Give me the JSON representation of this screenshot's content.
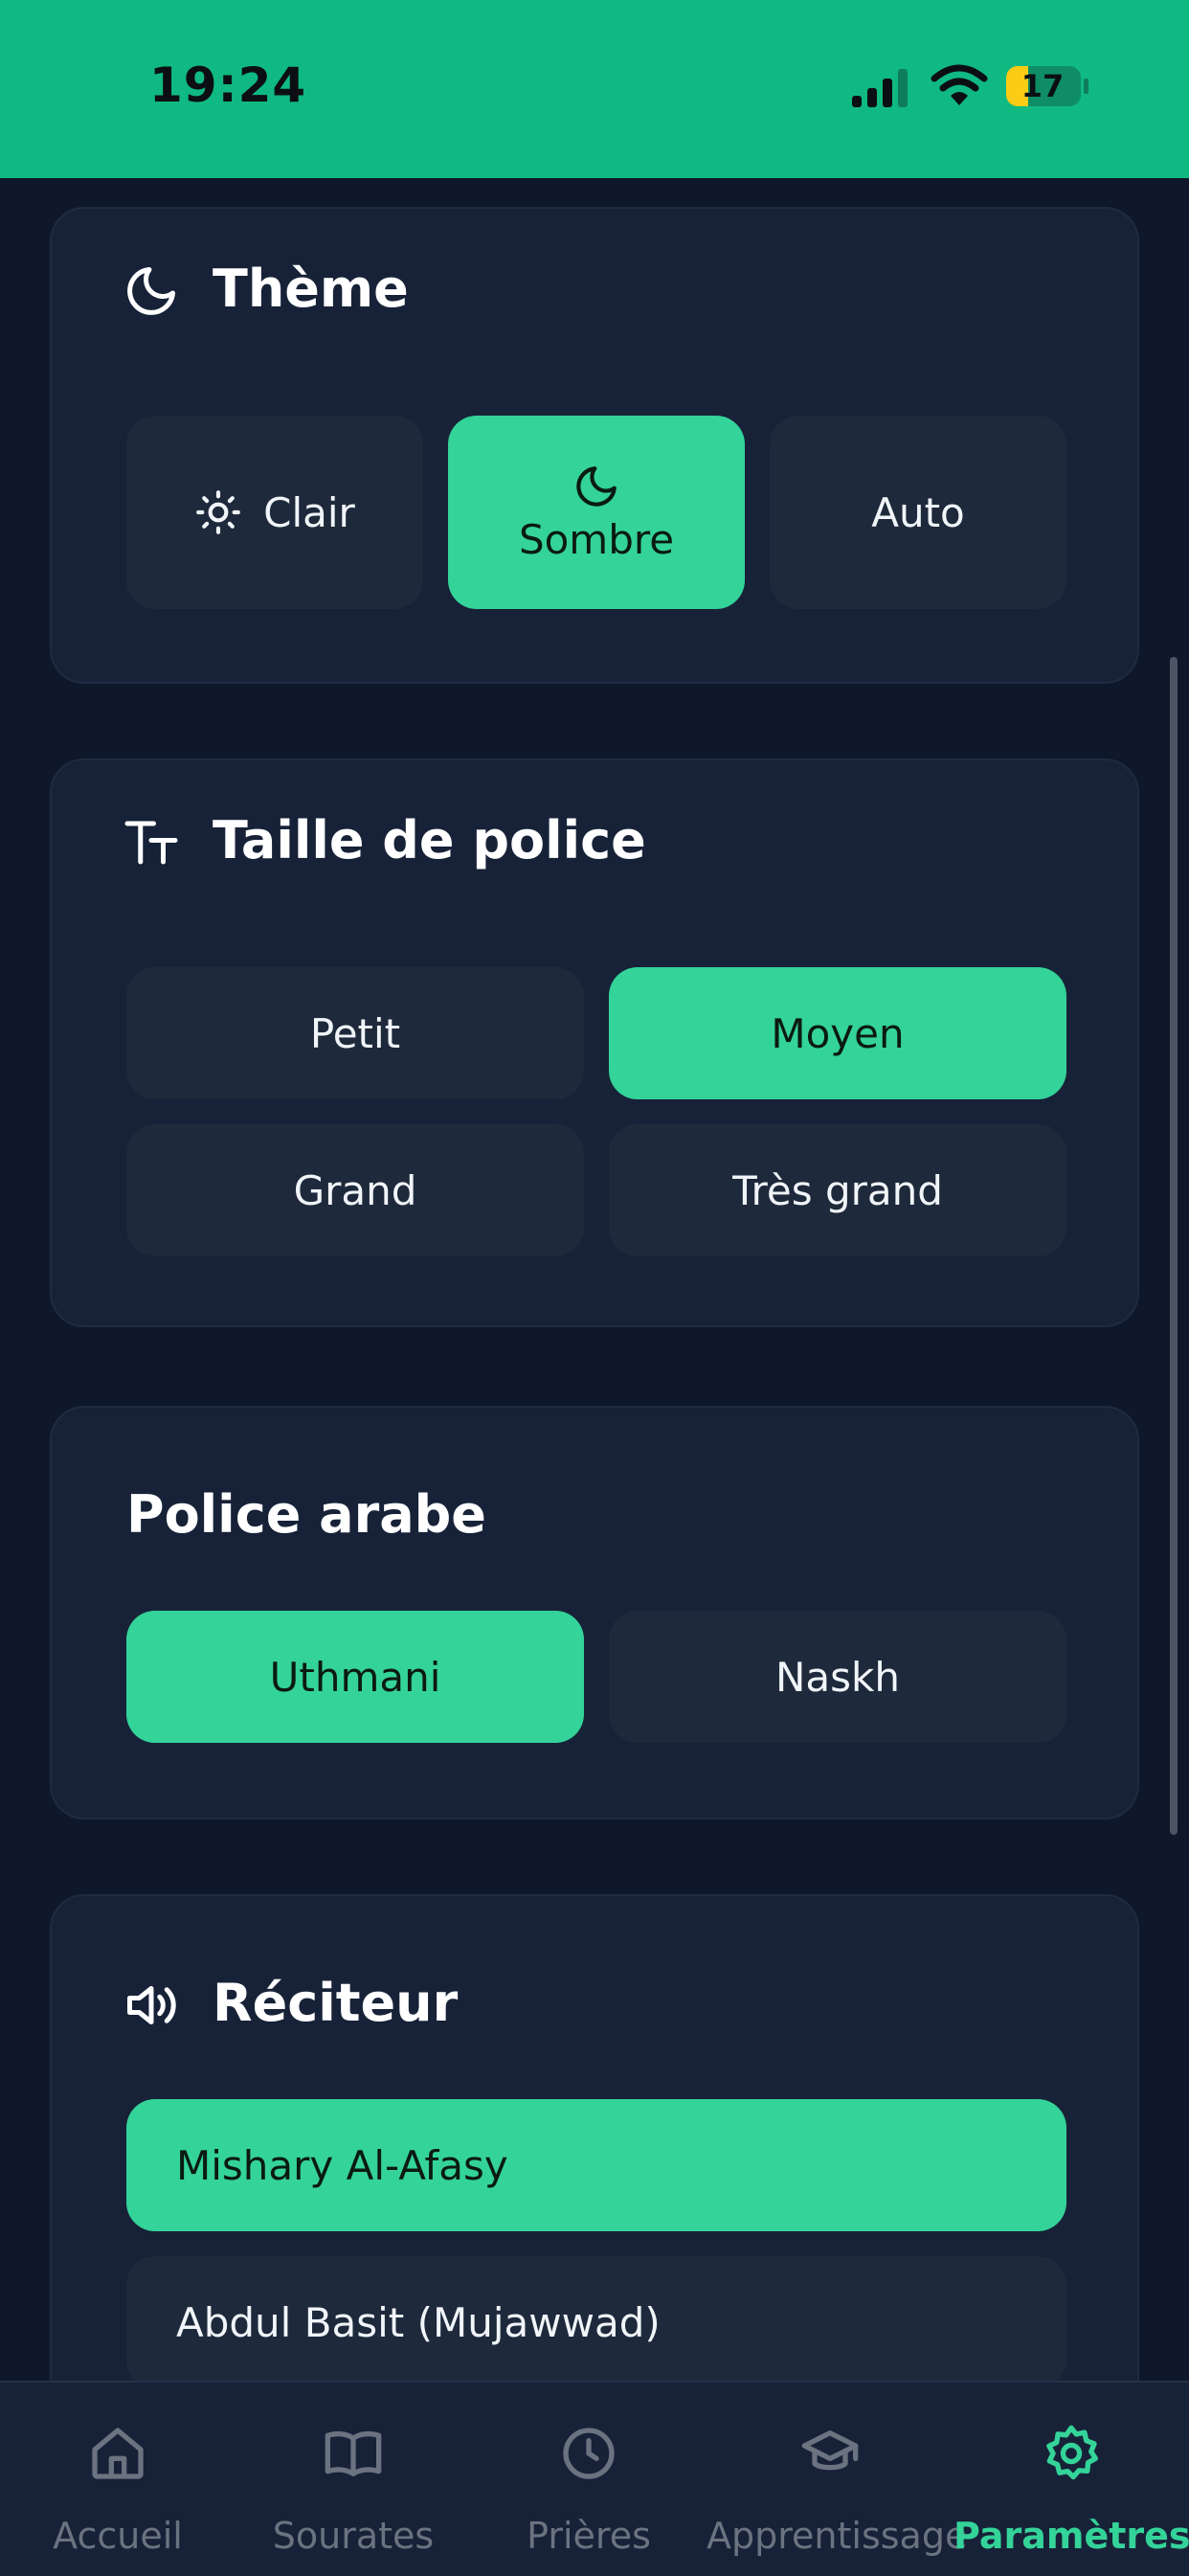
{
  "status_bar": {
    "time": "19:24",
    "battery": "17"
  },
  "theme": {
    "title": "Thème",
    "options": [
      "Clair",
      "Sombre",
      "Auto"
    ],
    "selected": "Sombre"
  },
  "font_size": {
    "title": "Taille de police",
    "options": [
      "Petit",
      "Moyen",
      "Grand",
      "Très grand"
    ],
    "selected": "Moyen"
  },
  "arabic_font": {
    "title": "Police arabe",
    "options": [
      "Uthmani",
      "Naskh"
    ],
    "selected": "Uthmani"
  },
  "reciter": {
    "title": "Réciteur",
    "options": [
      "Mishary Al-Afasy",
      "Abdul Basit (Mujawwad)"
    ],
    "selected": "Mishary Al-Afasy"
  },
  "bottom_nav": {
    "items": [
      "Accueil",
      "Sourates",
      "Prières",
      "Apprentissage",
      "Paramètres"
    ],
    "active": "Paramètres"
  },
  "colors": {
    "status_bar": "#10b981",
    "accent": "#34d399",
    "background": "#0f172a",
    "card": "#172238",
    "option": "#1e293b"
  },
  "icons": {
    "theme": "moon-icon",
    "font_size": "text-size-icon",
    "reciter": "speaker-icon",
    "light": "sun-icon",
    "dark": "moon-icon",
    "nav": [
      "home-icon",
      "book-icon",
      "clock-icon",
      "graduation-cap-icon",
      "gear-icon"
    ]
  }
}
